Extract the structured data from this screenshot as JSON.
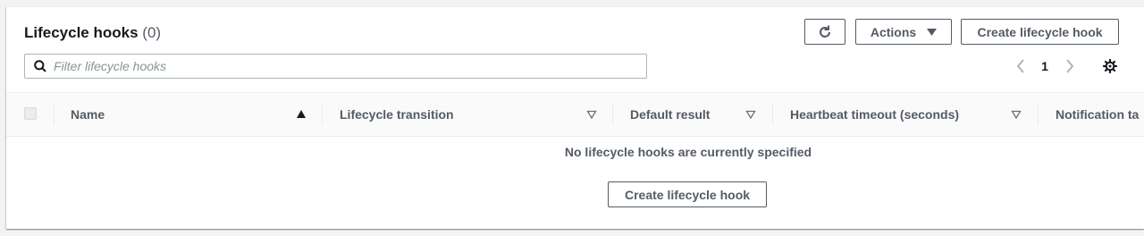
{
  "header": {
    "title": "Lifecycle hooks",
    "count": "(0)",
    "actions_label": "Actions",
    "create_label": "Create lifecycle hook"
  },
  "search": {
    "placeholder": "Filter lifecycle hooks",
    "value": ""
  },
  "pagination": {
    "current_page": "1"
  },
  "table": {
    "columns": [
      "Name",
      "Lifecycle transition",
      "Default result",
      "Heartbeat timeout (seconds)",
      "Notification ta"
    ],
    "empty_message": "No lifecycle hooks are currently specified",
    "empty_action_label": "Create lifecycle hook"
  },
  "icons": [
    "refresh-icon",
    "caret-down-icon",
    "search-icon",
    "chevron-left-icon",
    "chevron-right-icon",
    "gear-icon",
    "sort-ascending-icon",
    "sort-icon"
  ],
  "colors": {
    "text": "#16191f",
    "secondary": "#545b64",
    "border": "#eaeded",
    "background": "#f2f3f3"
  }
}
